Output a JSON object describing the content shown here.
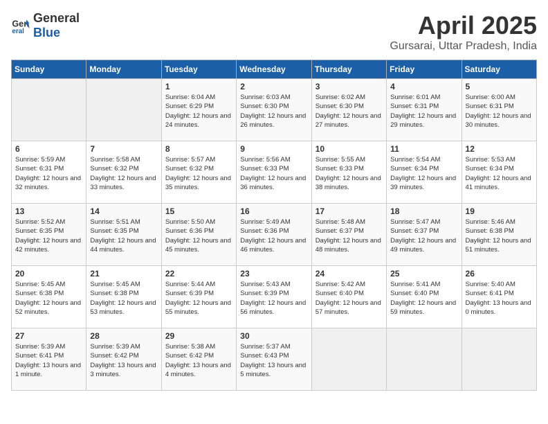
{
  "header": {
    "logo_general": "General",
    "logo_blue": "Blue",
    "month": "April 2025",
    "location": "Gursarai, Uttar Pradesh, India"
  },
  "weekdays": [
    "Sunday",
    "Monday",
    "Tuesday",
    "Wednesday",
    "Thursday",
    "Friday",
    "Saturday"
  ],
  "weeks": [
    [
      {
        "day": "",
        "sunrise": "",
        "sunset": "",
        "daylight": ""
      },
      {
        "day": "",
        "sunrise": "",
        "sunset": "",
        "daylight": ""
      },
      {
        "day": "1",
        "sunrise": "Sunrise: 6:04 AM",
        "sunset": "Sunset: 6:29 PM",
        "daylight": "Daylight: 12 hours and 24 minutes."
      },
      {
        "day": "2",
        "sunrise": "Sunrise: 6:03 AM",
        "sunset": "Sunset: 6:30 PM",
        "daylight": "Daylight: 12 hours and 26 minutes."
      },
      {
        "day": "3",
        "sunrise": "Sunrise: 6:02 AM",
        "sunset": "Sunset: 6:30 PM",
        "daylight": "Daylight: 12 hours and 27 minutes."
      },
      {
        "day": "4",
        "sunrise": "Sunrise: 6:01 AM",
        "sunset": "Sunset: 6:31 PM",
        "daylight": "Daylight: 12 hours and 29 minutes."
      },
      {
        "day": "5",
        "sunrise": "Sunrise: 6:00 AM",
        "sunset": "Sunset: 6:31 PM",
        "daylight": "Daylight: 12 hours and 30 minutes."
      }
    ],
    [
      {
        "day": "6",
        "sunrise": "Sunrise: 5:59 AM",
        "sunset": "Sunset: 6:31 PM",
        "daylight": "Daylight: 12 hours and 32 minutes."
      },
      {
        "day": "7",
        "sunrise": "Sunrise: 5:58 AM",
        "sunset": "Sunset: 6:32 PM",
        "daylight": "Daylight: 12 hours and 33 minutes."
      },
      {
        "day": "8",
        "sunrise": "Sunrise: 5:57 AM",
        "sunset": "Sunset: 6:32 PM",
        "daylight": "Daylight: 12 hours and 35 minutes."
      },
      {
        "day": "9",
        "sunrise": "Sunrise: 5:56 AM",
        "sunset": "Sunset: 6:33 PM",
        "daylight": "Daylight: 12 hours and 36 minutes."
      },
      {
        "day": "10",
        "sunrise": "Sunrise: 5:55 AM",
        "sunset": "Sunset: 6:33 PM",
        "daylight": "Daylight: 12 hours and 38 minutes."
      },
      {
        "day": "11",
        "sunrise": "Sunrise: 5:54 AM",
        "sunset": "Sunset: 6:34 PM",
        "daylight": "Daylight: 12 hours and 39 minutes."
      },
      {
        "day": "12",
        "sunrise": "Sunrise: 5:53 AM",
        "sunset": "Sunset: 6:34 PM",
        "daylight": "Daylight: 12 hours and 41 minutes."
      }
    ],
    [
      {
        "day": "13",
        "sunrise": "Sunrise: 5:52 AM",
        "sunset": "Sunset: 6:35 PM",
        "daylight": "Daylight: 12 hours and 42 minutes."
      },
      {
        "day": "14",
        "sunrise": "Sunrise: 5:51 AM",
        "sunset": "Sunset: 6:35 PM",
        "daylight": "Daylight: 12 hours and 44 minutes."
      },
      {
        "day": "15",
        "sunrise": "Sunrise: 5:50 AM",
        "sunset": "Sunset: 6:36 PM",
        "daylight": "Daylight: 12 hours and 45 minutes."
      },
      {
        "day": "16",
        "sunrise": "Sunrise: 5:49 AM",
        "sunset": "Sunset: 6:36 PM",
        "daylight": "Daylight: 12 hours and 46 minutes."
      },
      {
        "day": "17",
        "sunrise": "Sunrise: 5:48 AM",
        "sunset": "Sunset: 6:37 PM",
        "daylight": "Daylight: 12 hours and 48 minutes."
      },
      {
        "day": "18",
        "sunrise": "Sunrise: 5:47 AM",
        "sunset": "Sunset: 6:37 PM",
        "daylight": "Daylight: 12 hours and 49 minutes."
      },
      {
        "day": "19",
        "sunrise": "Sunrise: 5:46 AM",
        "sunset": "Sunset: 6:38 PM",
        "daylight": "Daylight: 12 hours and 51 minutes."
      }
    ],
    [
      {
        "day": "20",
        "sunrise": "Sunrise: 5:45 AM",
        "sunset": "Sunset: 6:38 PM",
        "daylight": "Daylight: 12 hours and 52 minutes."
      },
      {
        "day": "21",
        "sunrise": "Sunrise: 5:45 AM",
        "sunset": "Sunset: 6:38 PM",
        "daylight": "Daylight: 12 hours and 53 minutes."
      },
      {
        "day": "22",
        "sunrise": "Sunrise: 5:44 AM",
        "sunset": "Sunset: 6:39 PM",
        "daylight": "Daylight: 12 hours and 55 minutes."
      },
      {
        "day": "23",
        "sunrise": "Sunrise: 5:43 AM",
        "sunset": "Sunset: 6:39 PM",
        "daylight": "Daylight: 12 hours and 56 minutes."
      },
      {
        "day": "24",
        "sunrise": "Sunrise: 5:42 AM",
        "sunset": "Sunset: 6:40 PM",
        "daylight": "Daylight: 12 hours and 57 minutes."
      },
      {
        "day": "25",
        "sunrise": "Sunrise: 5:41 AM",
        "sunset": "Sunset: 6:40 PM",
        "daylight": "Daylight: 12 hours and 59 minutes."
      },
      {
        "day": "26",
        "sunrise": "Sunrise: 5:40 AM",
        "sunset": "Sunset: 6:41 PM",
        "daylight": "Daylight: 13 hours and 0 minutes."
      }
    ],
    [
      {
        "day": "27",
        "sunrise": "Sunrise: 5:39 AM",
        "sunset": "Sunset: 6:41 PM",
        "daylight": "Daylight: 13 hours and 1 minute."
      },
      {
        "day": "28",
        "sunrise": "Sunrise: 5:39 AM",
        "sunset": "Sunset: 6:42 PM",
        "daylight": "Daylight: 13 hours and 3 minutes."
      },
      {
        "day": "29",
        "sunrise": "Sunrise: 5:38 AM",
        "sunset": "Sunset: 6:42 PM",
        "daylight": "Daylight: 13 hours and 4 minutes."
      },
      {
        "day": "30",
        "sunrise": "Sunrise: 5:37 AM",
        "sunset": "Sunset: 6:43 PM",
        "daylight": "Daylight: 13 hours and 5 minutes."
      },
      {
        "day": "",
        "sunrise": "",
        "sunset": "",
        "daylight": ""
      },
      {
        "day": "",
        "sunrise": "",
        "sunset": "",
        "daylight": ""
      },
      {
        "day": "",
        "sunrise": "",
        "sunset": "",
        "daylight": ""
      }
    ]
  ]
}
